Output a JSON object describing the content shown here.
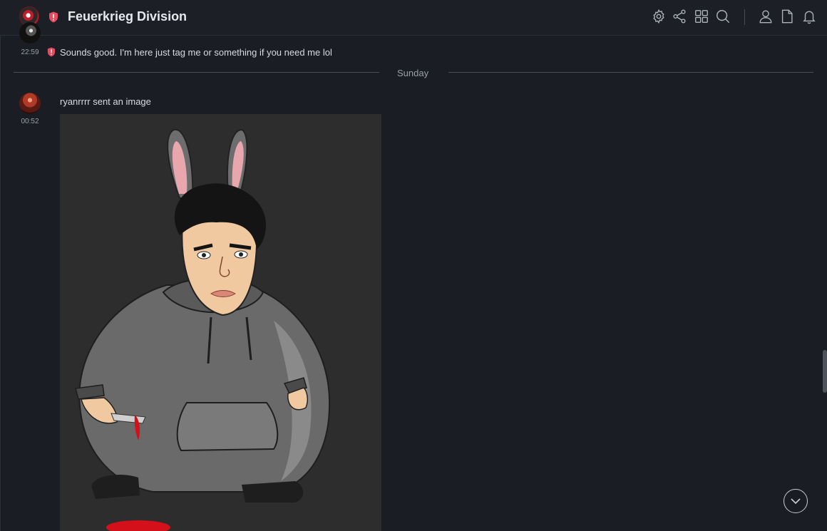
{
  "header": {
    "room_title": "Feuerkrieg Division",
    "icons": [
      "settings-icon",
      "share-icon",
      "grid-icon",
      "search-icon",
      "user-icon",
      "file-icon",
      "bell-icon"
    ]
  },
  "messages": [
    {
      "time": "22:59",
      "text": "Sounds good. I'm here just tag me or something if you need me lol"
    },
    {
      "time": "00:52",
      "text": "ryanrrrr sent an image"
    }
  ],
  "date_divider": "Sunday",
  "colors": {
    "background": "#1a1d23",
    "header": "#1c1f26",
    "shield_red": "#e84a5f",
    "image_bg": "#2d2d2d"
  }
}
